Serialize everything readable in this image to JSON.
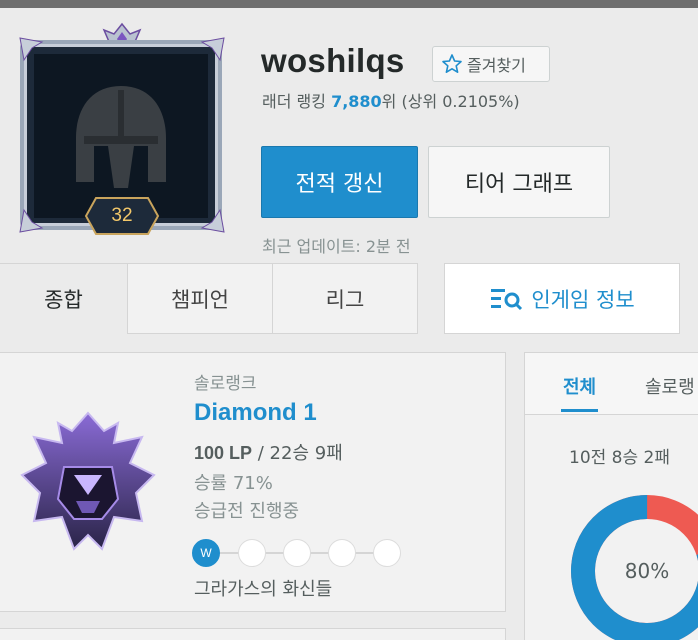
{
  "profile": {
    "summoner_name": "woshilqs",
    "level": "32",
    "favorite_label": "즐겨찾기",
    "ladder_prefix": "래더 랭킹 ",
    "ladder_rank": "7,880",
    "ladder_suffix": "위 (상위 0.2105%)",
    "renew_label": "전적 갱신",
    "tier_graph_label": "티어 그래프",
    "last_update": "최근 업데이트: 2분 전"
  },
  "tabs": [
    {
      "label": "종합",
      "active": true
    },
    {
      "label": "챔피언",
      "active": false
    },
    {
      "label": "리그",
      "active": false
    }
  ],
  "ingame_tab": {
    "label": "인게임 정보"
  },
  "rank": {
    "queue_type": "솔로랭크",
    "tier": "Diamond 1",
    "lp": "100 LP",
    "record": " / 22승 9패",
    "winrate": "승률 71%",
    "promo_status": "승급전 진행중",
    "promo_series": [
      "W",
      "",
      "",
      "",
      ""
    ],
    "league_name": "그라가스의 화신들"
  },
  "recent": {
    "tabs": [
      "전체",
      "솔로랭"
    ],
    "summary": "10전 8승 2패",
    "win_ratio": 0.8,
    "win_ratio_label": "80%",
    "win_color": "#1f8ecd",
    "loss_color": "#ee5a52"
  },
  "colors": {
    "accent": "#1f8ecd",
    "background": "#ebebeb"
  },
  "icons": {
    "profile": "helmet-icon",
    "favorite": "star-icon",
    "ingame": "search-list-icon",
    "rank_emblem": "diamond-emblem-icon"
  }
}
